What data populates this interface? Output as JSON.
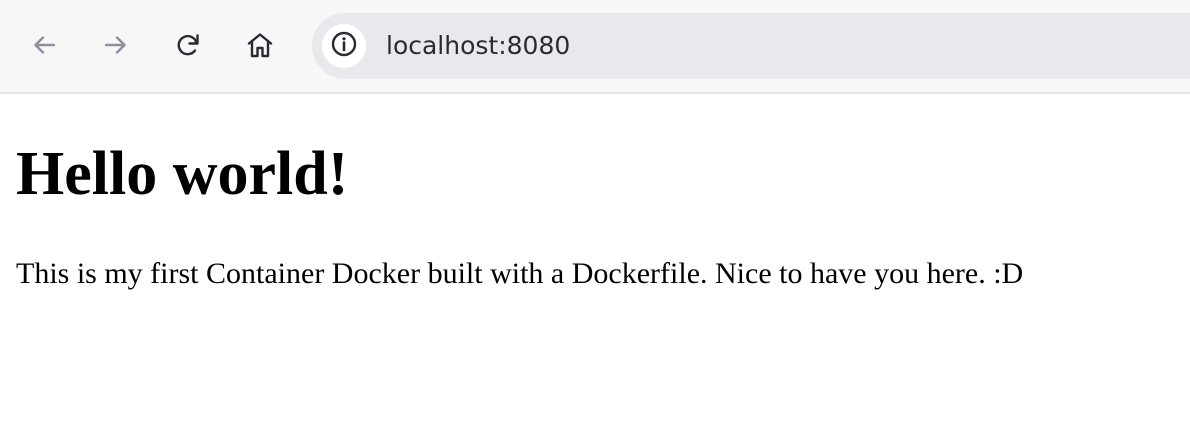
{
  "browser": {
    "back_icon": "arrow-left-icon",
    "forward_icon": "arrow-right-icon",
    "reload_icon": "reload-icon",
    "home_icon": "home-icon",
    "site_info_icon": "info-circle-icon",
    "url": "localhost:8080"
  },
  "page": {
    "heading": "Hello world!",
    "paragraph": "This is my first Container Docker built with a Dockerfile. Nice to have you here. :D"
  },
  "colors": {
    "toolbar_bg": "#f7f7f8",
    "urlbar_bg": "#e9e9ed",
    "icon_active": "#2b2a33",
    "icon_disabled": "#8f8f9d",
    "page_bg": "#ffffff",
    "text": "#000000"
  }
}
